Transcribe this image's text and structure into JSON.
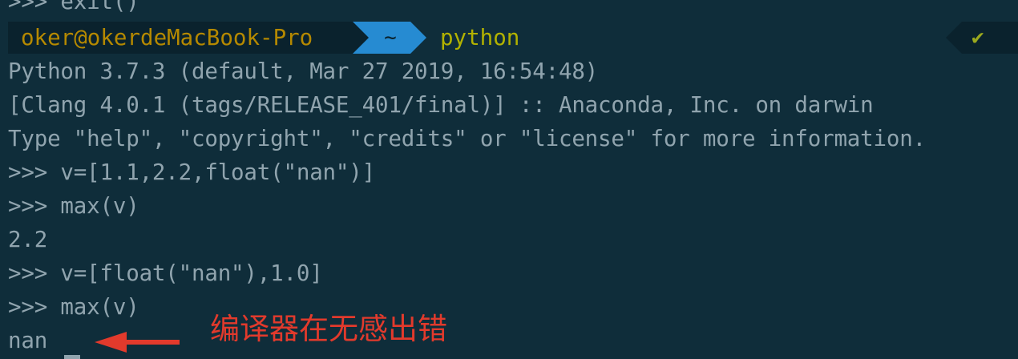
{
  "terminal": {
    "lines": [
      ">>> exit()",
      "Python 3.7.3 (default, Mar 27 2019, 16:54:48)",
      "[Clang 4.0.1 (tags/RELEASE_401/final)] :: Anaconda, Inc. on darwin",
      "Type \"help\", \"copyright\", \"credits\" or \"license\" for more information.",
      ">>> v=[1.1,2.2,float(\"nan\")]",
      ">>> max(v)",
      "2.2",
      ">>> v=[float(\"nan\"),1.0]",
      ">>> max(v)",
      "nan"
    ]
  },
  "prompt": {
    "user_host": "oker@okerdeMacBook-Pro",
    "directory": "~",
    "command": "python",
    "status_icon": "check-mark-icon",
    "status_glyph": "✔"
  },
  "annotation": {
    "text": "编译器在无感出错",
    "color": "#e23a2c"
  },
  "colors": {
    "background": "#0f2d3a",
    "text": "#90a4ae",
    "segment_dark": "#0a222d",
    "segment_blue": "#268bd2",
    "command": "#b2b200",
    "status_ok": "#9aa81e"
  }
}
